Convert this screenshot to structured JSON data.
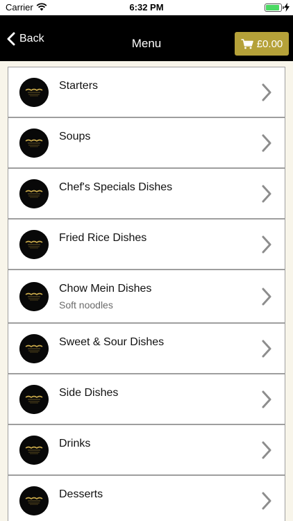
{
  "status_bar": {
    "carrier": "Carrier",
    "time": "6:32 PM",
    "battery_level": 0.92,
    "battery_color": "#4cd964"
  },
  "nav": {
    "back_label": "Back",
    "title": "Menu",
    "cart_label": "£0.00",
    "cart_color": "#b5a139",
    "bar_color": "#000000"
  },
  "menu": {
    "items": [
      {
        "title": "Starters",
        "subtitle": ""
      },
      {
        "title": "Soups",
        "subtitle": ""
      },
      {
        "title": "Chef's Specials Dishes",
        "subtitle": ""
      },
      {
        "title": "Fried Rice Dishes",
        "subtitle": ""
      },
      {
        "title": "Chow Mein Dishes",
        "subtitle": "Soft noodles"
      },
      {
        "title": "Sweet & Sour Dishes",
        "subtitle": ""
      },
      {
        "title": "Side Dishes",
        "subtitle": ""
      },
      {
        "title": "Drinks",
        "subtitle": ""
      },
      {
        "title": "Desserts",
        "subtitle": ""
      }
    ]
  },
  "icons": {
    "logo": "restaurant-logo-icon",
    "chevron": "chevron-right-icon",
    "back": "chevron-left-icon",
    "cart": "cart-icon",
    "wifi": "wifi-icon",
    "battery": "battery-icon",
    "charging": "charging-bolt-icon"
  }
}
